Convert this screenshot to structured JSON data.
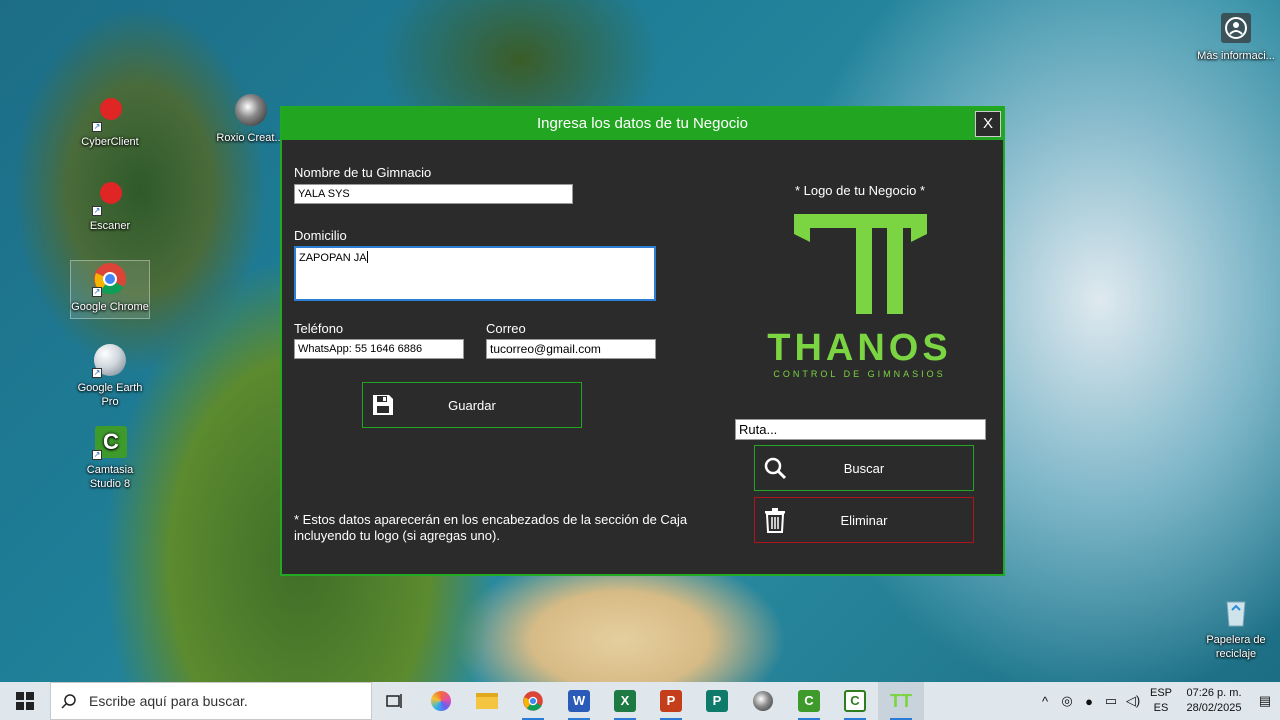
{
  "desktop": {
    "icons": [
      {
        "label": "CyberClient"
      },
      {
        "label": "Escaner"
      },
      {
        "label": "Google Chrome"
      },
      {
        "label": "Google Earth Pro"
      },
      {
        "label": "Camtasia Studio 8"
      },
      {
        "label": "Roxio Creat..."
      },
      {
        "label": "Más informaci..."
      },
      {
        "label": "Papelera de reciclaje"
      }
    ]
  },
  "dialog": {
    "title": "Ingresa los datos de tu Negocio",
    "close_label": "X",
    "gym_name_label": "Nombre de tu Gimnacio",
    "gym_name_value": "YALA SYS",
    "address_label": "Domicilio",
    "address_value": "ZAPOPAN JA",
    "phone_label": "Teléfono",
    "phone_value": "WhatsApp: 55 1646 6886",
    "email_label": "Correo",
    "email_value": "tucorreo@gmail.com",
    "save_label": "Guardar",
    "logo_label": "* Logo de tu Negocio *",
    "logo_brand": "THANOS",
    "logo_tagline": "CONTROL DE GIMNASIOS",
    "path_value": "Ruta...",
    "search_label": "Buscar",
    "delete_label": "Eliminar",
    "note_line1": "* Estos datos aparecerán en los encabezados de la sección de Caja",
    "note_line2": "incluyendo tu logo (si agregas uno).",
    "colors": {
      "accent": "#22a622",
      "danger": "#b0141e",
      "logo": "#7bd442"
    }
  },
  "taskbar": {
    "search_placeholder": "Escribe aquí para buscar.",
    "lang_top": "ESP",
    "lang_bottom": "ES",
    "time": "07:26 p. m.",
    "date": "28/02/2025",
    "apps": [
      "task-view-icon",
      "copilot-icon",
      "file-explorer-icon",
      "chrome-icon",
      "word-icon",
      "excel-icon",
      "powerpoint-icon",
      "publisher-icon",
      "roxio-icon",
      "camtasia-icon",
      "camtasia-recorder-icon",
      "thanos-icon"
    ]
  }
}
